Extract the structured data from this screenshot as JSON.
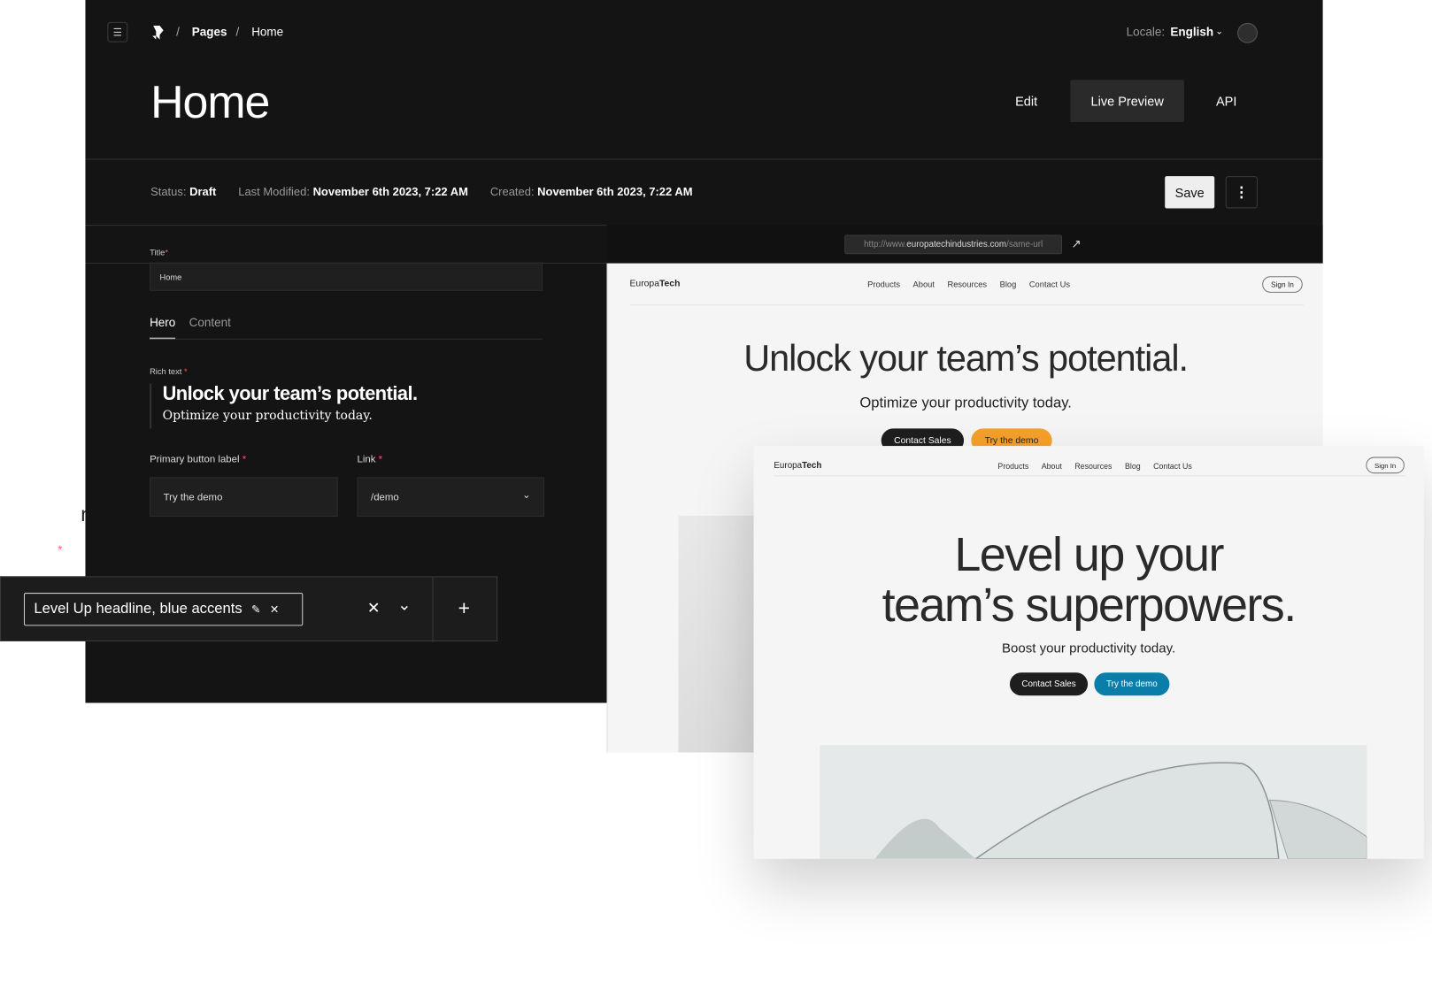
{
  "header": {
    "breadcrumb": [
      "Pages",
      "Home"
    ],
    "locale_label": "Locale:",
    "locale_value": "English",
    "page_title": "Home",
    "view_tabs": [
      {
        "label": "Edit"
      },
      {
        "label": "Live Preview",
        "active": true
      },
      {
        "label": "API"
      }
    ]
  },
  "meta": {
    "status_label": "Status:",
    "status_value": "Draft",
    "modified_label": "Last Modified:",
    "modified_value": "November 6th 2023, 7:22 AM",
    "created_label": "Created:",
    "created_value": "November 6th 2023, 7:22 AM",
    "save_label": "Save"
  },
  "form": {
    "title_label": "Title",
    "title_value": "Home",
    "tabs": [
      {
        "label": "Hero",
        "active": true
      },
      {
        "label": "Content"
      }
    ],
    "rich_text_label": "Rich text",
    "rich_headline": "Unlock your team’s potential.",
    "rich_subline": "Optimize your productivity today.",
    "primary_label": "Primary button label",
    "primary_value": "Try the demo",
    "link_label": "Link",
    "link_value": "/demo",
    "required_mark": "*"
  },
  "background_fragment": {
    "text": "ng",
    "asterisk": "*"
  },
  "variant_bar": {
    "chip_label": "Level Up headline, blue accents"
  },
  "preview": {
    "url_prefix": "http://www.",
    "url_domain": "europatechindustries.com",
    "url_path": "/same-url",
    "logo_light": "Europa",
    "logo_bold": "Tech",
    "nav": [
      "Products",
      "About",
      "Resources",
      "Blog",
      "Contact Us"
    ],
    "sign_in": "Sign In",
    "headline": "Unlock your team’s potential.",
    "subline": "Optimize your productivity today.",
    "btn_secondary": "Contact Sales",
    "btn_primary": "Try the demo",
    "primary_color": "#f5a02a"
  },
  "variant_preview": {
    "headline_1": "Level up your",
    "headline_2": "team’s superpowers.",
    "subline": "Boost your productivity today.",
    "btn_secondary": "Contact Sales",
    "btn_primary": "Try the demo",
    "primary_color": "#0a7ea8"
  }
}
